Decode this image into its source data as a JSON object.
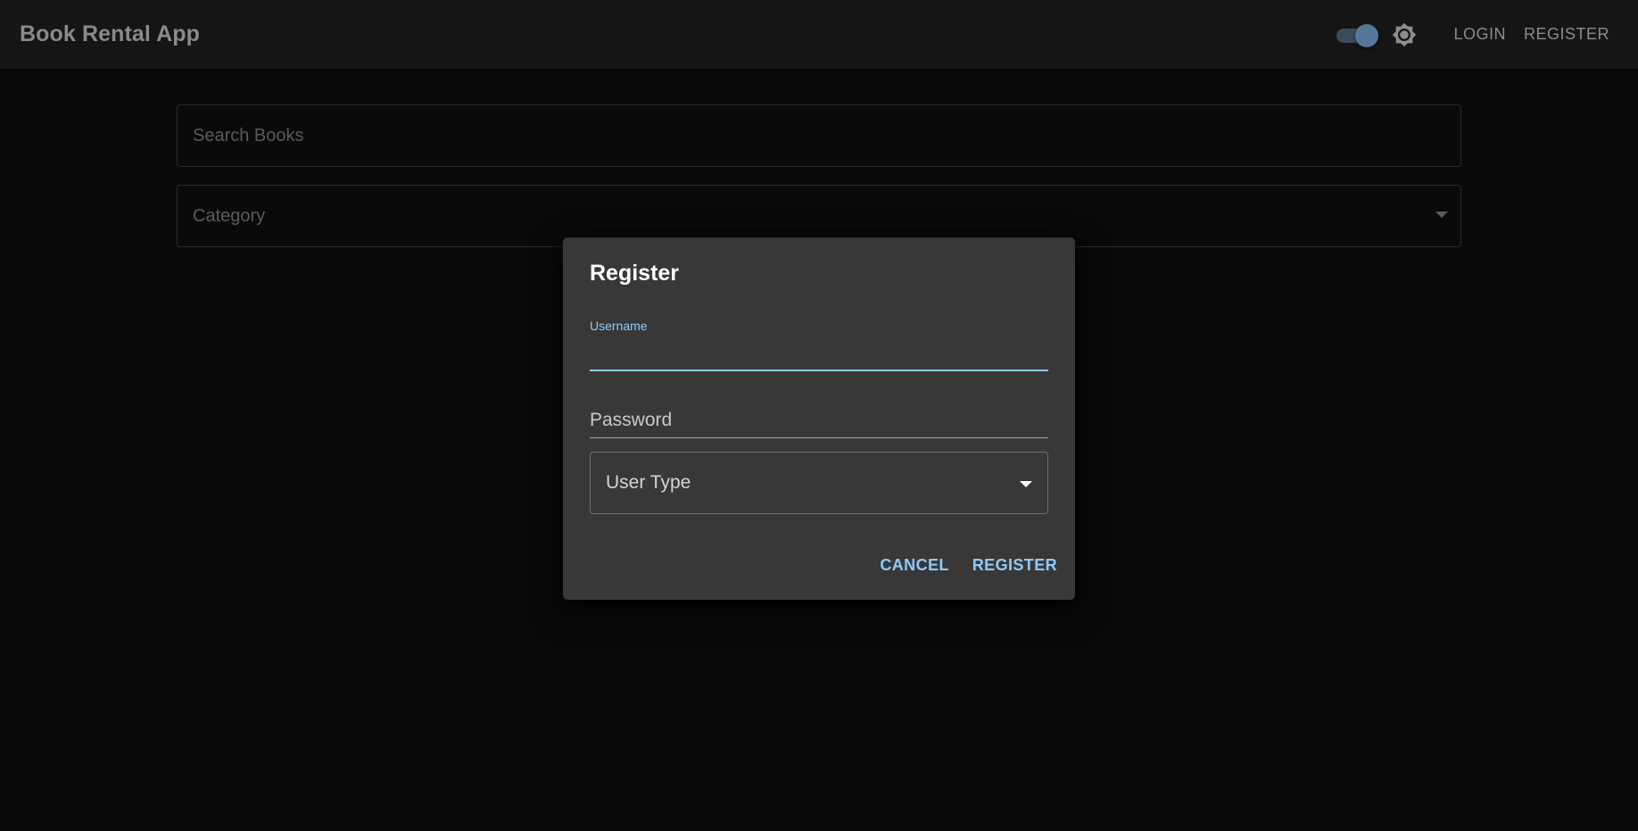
{
  "appbar": {
    "title": "Book Rental App",
    "theme_toggle_on": true,
    "theme_icon": "brightness-icon",
    "login_label": "LOGIN",
    "register_label": "REGISTER"
  },
  "filters": {
    "search_placeholder": "Search Books",
    "category_label": "Category"
  },
  "dialog": {
    "title": "Register",
    "username_label": "Username",
    "username_value": "",
    "password_placeholder": "Password",
    "user_type_label": "User Type",
    "cancel_label": "CANCEL",
    "register_label": "REGISTER"
  },
  "colors": {
    "accent": "#90caf9",
    "dialog_bg": "#383838",
    "page_bg": "#0a0a0a",
    "appbar_bg": "#151515"
  }
}
